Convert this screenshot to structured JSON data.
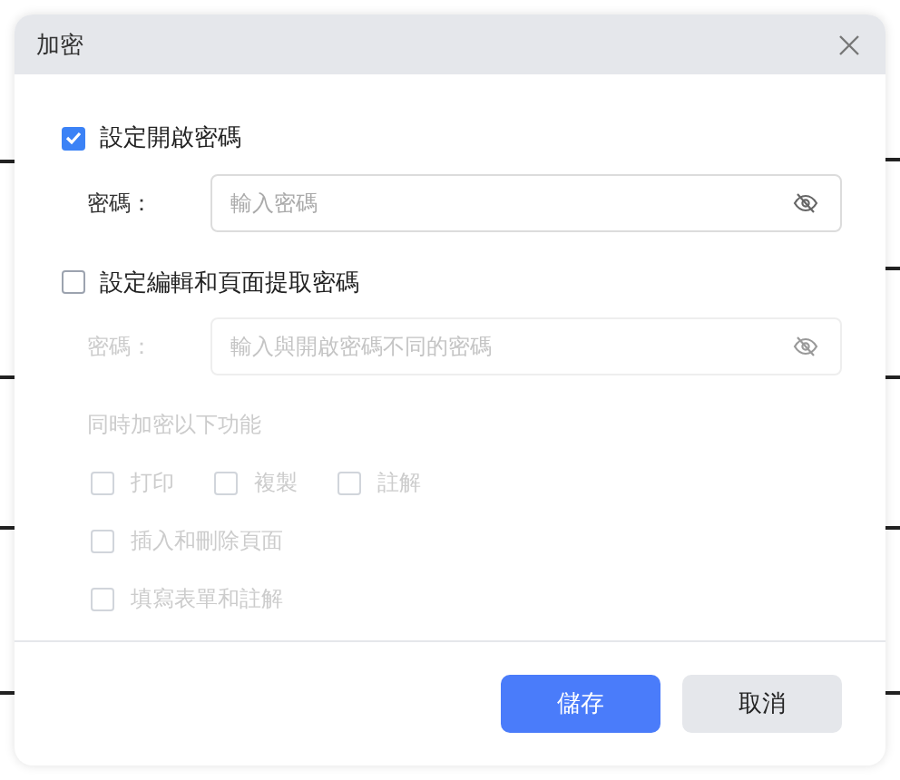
{
  "dialog": {
    "title": "加密"
  },
  "password_sections": [
    {
      "label": "設定開啟密碼",
      "checked": true,
      "field_label": "密碼：",
      "placeholder": "輸入密碼",
      "disabled": false
    },
    {
      "label": "設定編輯和頁面提取密碼",
      "checked": false,
      "field_label": "密碼：",
      "placeholder": "輸入與開啟密碼不同的密碼",
      "disabled": true
    }
  ],
  "permissions": {
    "label": "同時加密以下功能",
    "disabled": true,
    "rows": [
      [
        {
          "label": "打印",
          "checked": false
        },
        {
          "label": "複製",
          "checked": false
        },
        {
          "label": "註解",
          "checked": false
        }
      ],
      [
        {
          "label": "插入和刪除頁面",
          "checked": false
        }
      ],
      [
        {
          "label": "填寫表單和註解",
          "checked": false
        }
      ]
    ]
  },
  "buttons": [
    {
      "label": "儲存",
      "kind": "primary"
    },
    {
      "label": "取消",
      "kind": "secondary"
    }
  ]
}
